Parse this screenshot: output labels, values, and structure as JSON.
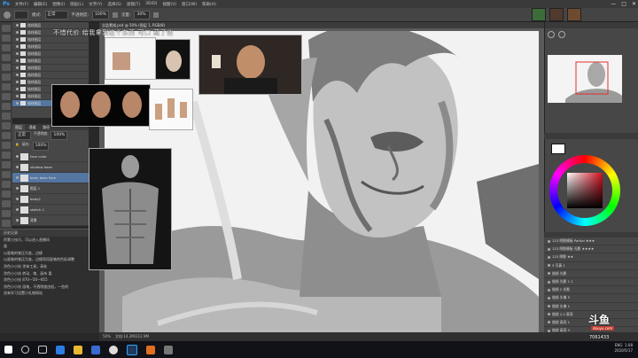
{
  "app": {
    "logo": "Ps"
  },
  "menu": {
    "items": [
      "文件(F)",
      "编辑(E)",
      "图像(I)",
      "图层(L)",
      "文字(Y)",
      "选择(S)",
      "滤镜(T)",
      "3D(D)",
      "视图(V)",
      "窗口(W)",
      "帮助(H)"
    ]
  },
  "window_controls": [
    "—",
    "□",
    "✕"
  ],
  "options": {
    "mode_label": "模式:",
    "mode_value": "正常",
    "opacity_label": "不透明度:",
    "opacity_value": "100%",
    "flow_label": "流量:",
    "flow_value": "30%"
  },
  "document_tab": "总监素描.psd @ 50% (图层 1, RGB/8)",
  "watermark": "不惜代价 给我拿到这个东西 可口 藏了他",
  "left_layers": [
    "描线图层",
    "描线图层",
    "描线图层",
    "描线图层",
    "描线图层",
    "描线图层",
    "描线图层",
    "描线图层",
    "描线图层",
    "描线图层",
    "描线图层",
    "描线图层"
  ],
  "layers_panel": {
    "tabs": [
      "图层",
      "通道",
      "路径"
    ],
    "blend": "正常",
    "opacity_label": "不透明度:",
    "opacity_value": "100%",
    "fill_label": "填充:",
    "fill_value": "100%",
    "rows": [
      "face color",
      "shadow base",
      "body base face",
      "图层 1",
      "body2",
      "sketch 1",
      "背景"
    ]
  },
  "info_panel": {
    "title": "历史记录",
    "lines": [
      "积累小技巧，可以进入直播间",
      "画",
      "以画笔的笔压为准，边缘",
      "以画笔的笔压为准，边缘再用画笔的色彩调整",
      "涂色小小技 涂抹工具，高处",
      "涂色小小技 转动、笔、画布 柔",
      "涂色小小技 870—50—855",
      "涂色小小技 画笔，不透明度由低，一些的",
      "",
      "",
      "进来学习设置小礼物网站"
    ]
  },
  "right_layers": [
    "123 阴影模板 Partial ★★★",
    "123 阴影模板 光影 ★★★★",
    "123 阴影 ★★",
    "5 写真 1",
    "描线 光影",
    "描线 光影 1 1",
    "描线 2 光影",
    "描线 头像 5",
    "描线 头像 1",
    "描线 2.2 高亮",
    "描线 高亮 1",
    "描线 高亮 3",
    "描线 高亮 2"
  ],
  "status": {
    "zoom": "50%",
    "doc": "文档:14.2M/312.9M"
  },
  "taskbar": {
    "time": "1:08",
    "date": "2020/5/17",
    "lang": "ENG"
  },
  "branding": {
    "logo": "斗鱼",
    "sub": "douyu.com",
    "room": "7061433"
  },
  "colors": {
    "accent": "#33a1fd",
    "selected": "#5476a0",
    "panel": "#474747"
  }
}
